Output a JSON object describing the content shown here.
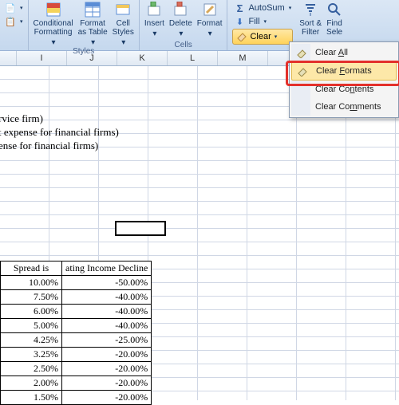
{
  "ribbon": {
    "groups": {
      "styles": {
        "label": "Styles",
        "cond_fmt": "Conditional\nFormatting",
        "fmt_table": "Format\nas Table",
        "cell_styles": "Cell\nStyles"
      },
      "cells": {
        "label": "Cells",
        "insert": "Insert",
        "delete": "Delete",
        "format": "Format"
      },
      "editing": {
        "autosum": "AutoSum",
        "fill": "Fill",
        "clear": "Clear",
        "sort": "Sort &\nFilter",
        "find": "Find\nSele"
      }
    }
  },
  "columns": [
    "I",
    "J",
    "K",
    "L",
    "M"
  ],
  "sheet_text": {
    "t1": "rvice firm)",
    "t2": "t expense for financial firms)",
    "t3": "ense for financial firms)"
  },
  "table": {
    "head1": "Spread is",
    "head2": "ating Income Decline",
    "rows": [
      [
        "10.00%",
        "-50.00%"
      ],
      [
        "7.50%",
        "-40.00%"
      ],
      [
        "6.00%",
        "-40.00%"
      ],
      [
        "5.00%",
        "-40.00%"
      ],
      [
        "4.25%",
        "-25.00%"
      ],
      [
        "3.25%",
        "-20.00%"
      ],
      [
        "2.50%",
        "-20.00%"
      ],
      [
        "2.00%",
        "-20.00%"
      ],
      [
        "1.50%",
        "-20.00%"
      ]
    ]
  },
  "menu": {
    "clear_all": "Clear All",
    "clear_formats": "Clear Formats",
    "clear_formats_pre": "Clear ",
    "clear_formats_u": "F",
    "clear_formats_post": "ormats",
    "clear_contents": "Clear Contents",
    "clear_contents_pre": "Clear Co",
    "clear_contents_u": "n",
    "clear_contents_post": "tents",
    "clear_comments": "Clear Comments",
    "clear_comments_pre": "Clear Co",
    "clear_comments_u": "m",
    "clear_comments_post": "ments",
    "clear_all_pre": "Clear ",
    "clear_all_u": "A",
    "clear_all_post": "ll"
  }
}
